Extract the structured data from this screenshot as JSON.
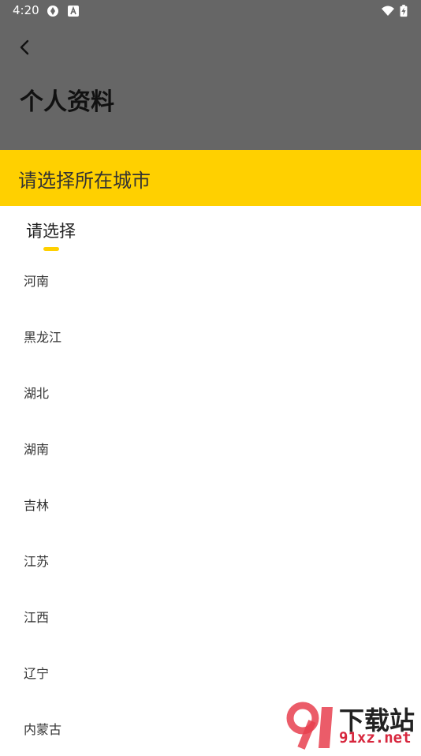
{
  "status_bar": {
    "time": "4:20",
    "icons": [
      "sync-icon",
      "notification-a-icon",
      "wifi-icon",
      "battery-charging-icon"
    ]
  },
  "app_bar": {
    "back_icon": "chevron-left-icon",
    "title": "个人资料",
    "background": "#666666"
  },
  "picker": {
    "header_title": "请选择所在城市",
    "header_color": "#FFD000",
    "tab_label": "请选择",
    "items": [
      "河南",
      "黑龙江",
      "湖北",
      "湖南",
      "吉林",
      "江苏",
      "江西",
      "辽宁",
      "内蒙古"
    ]
  },
  "watermark": {
    "brand": "下载站",
    "domain": "91xz.net"
  }
}
